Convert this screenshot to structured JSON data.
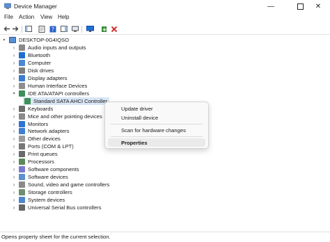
{
  "window": {
    "title": "Device Manager"
  },
  "menu": [
    "File",
    "Action",
    "View",
    "Help"
  ],
  "tree": {
    "root": "DESKTOP-0G4IQSO",
    "categories": [
      {
        "label": "Audio inputs and outputs",
        "icon": "audio-icon"
      },
      {
        "label": "Bluetooth",
        "icon": "bluetooth-icon"
      },
      {
        "label": "Computer",
        "icon": "computer-icon"
      },
      {
        "label": "Disk drives",
        "icon": "disk-drive-icon"
      },
      {
        "label": "Display adapters",
        "icon": "display-adapter-icon"
      },
      {
        "label": "Human Interface Devices",
        "icon": "hid-icon"
      },
      {
        "label": "IDE ATA/ATAPI controllers",
        "icon": "ide-controller-icon",
        "expanded": true,
        "children": [
          {
            "label": "Standard SATA AHCI Controller",
            "icon": "sata-controller-icon",
            "selected": true
          }
        ]
      },
      {
        "label": "Keyboards",
        "icon": "keyboard-icon"
      },
      {
        "label": "Mice and other pointing devices",
        "icon": "mouse-icon"
      },
      {
        "label": "Monitors",
        "icon": "monitor-icon"
      },
      {
        "label": "Network adapters",
        "icon": "network-adapter-icon"
      },
      {
        "label": "Other devices",
        "icon": "other-devices-icon"
      },
      {
        "label": "Ports (COM & LPT)",
        "icon": "ports-icon"
      },
      {
        "label": "Print queues",
        "icon": "printer-icon"
      },
      {
        "label": "Processors",
        "icon": "processor-icon"
      },
      {
        "label": "Software components",
        "icon": "software-component-icon"
      },
      {
        "label": "Software devices",
        "icon": "software-device-icon"
      },
      {
        "label": "Sound, video and game controllers",
        "icon": "sound-icon"
      },
      {
        "label": "Storage controllers",
        "icon": "storage-controller-icon"
      },
      {
        "label": "System devices",
        "icon": "system-devices-icon"
      },
      {
        "label": "Universal Serial Bus controllers",
        "icon": "usb-icon"
      }
    ]
  },
  "context_menu": {
    "items": [
      "Update driver",
      "Uninstall device",
      "Scan for hardware changes",
      "Properties"
    ],
    "highlighted": "Properties"
  },
  "status": {
    "text": "Opens property sheet for the current selection."
  },
  "colors": {
    "selection": "#d9e6f5",
    "accent_red": "#d32f2f",
    "toolbar_blue": "#1e6fd9"
  }
}
